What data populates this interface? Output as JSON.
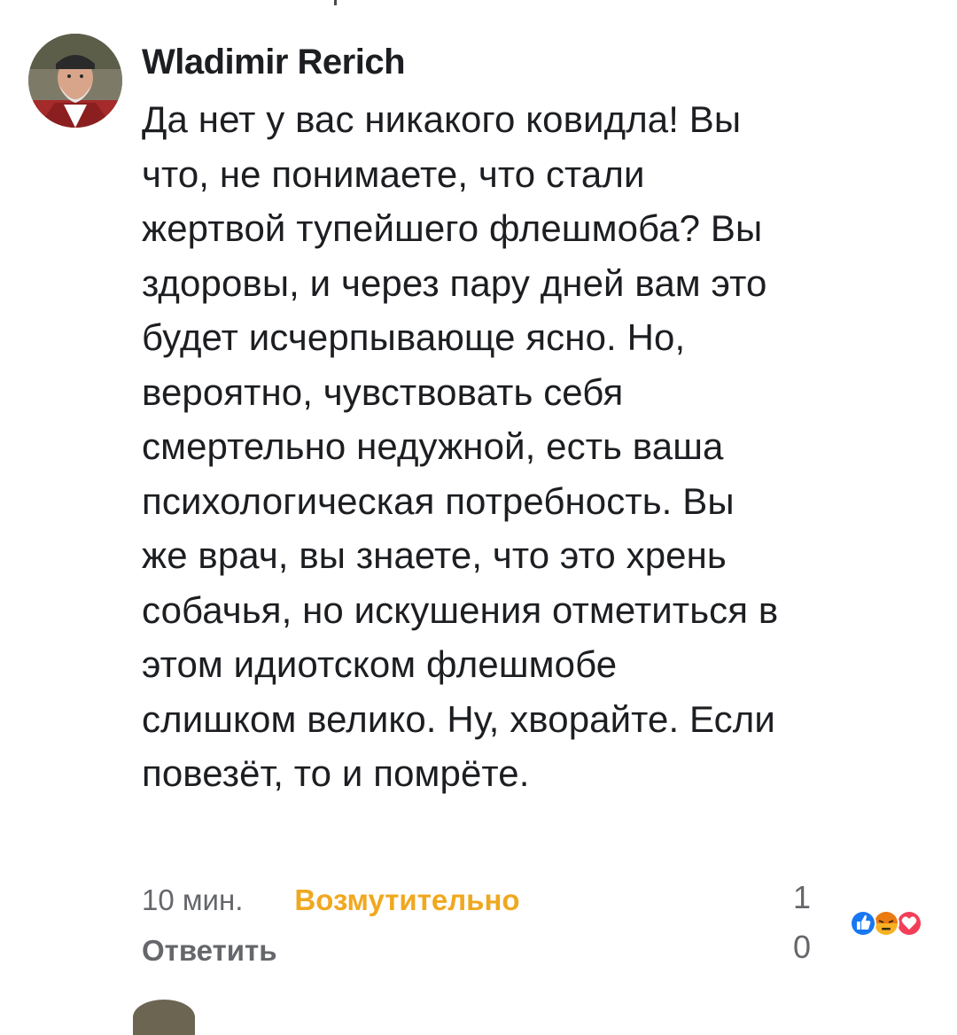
{
  "comment": {
    "author": "Wladimir Rerich",
    "text_lines": [
      "Да нет у вас никакого ковидла! Вы",
      "что, не понимаете, что стали",
      "жертвой тупейшего флешмоба? Вы",
      "здоровы, и через пару дней вам это",
      "будет исчерпывающе ясно. Но,",
      "вероятно, чувствовать себя",
      "смертельно недужной, есть ваша",
      "психологическая потребность. Вы",
      "же врач, вы знаете, что это хрень",
      "собачья, но искушения отметиться в",
      "этом идиотском флешмобе",
      "слишком велико. Ну, хворайте. Если",
      "повезёт, то и помрёте."
    ],
    "time": "10 мин.",
    "reaction_label": "Возмутительно",
    "reply_label": "Ответить",
    "reaction_count_top": "1",
    "reaction_count_bottom": "0",
    "reaction_icons": [
      "like-icon",
      "angry-icon",
      "love-icon"
    ]
  },
  "colors": {
    "text": "#1c1e21",
    "secondary": "#65676b",
    "angry_accent": "#f0a81f",
    "like_blue": "#1877f2",
    "love_red": "#f33e58"
  }
}
